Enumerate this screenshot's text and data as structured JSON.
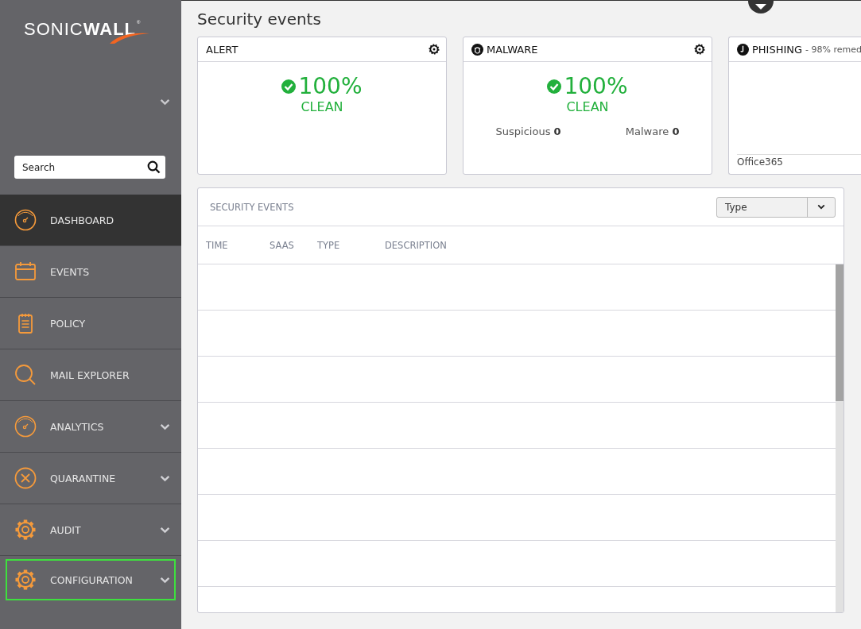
{
  "sidebar": {
    "logo": {
      "text": "SONIC**WALL**",
      "mark": "®"
    },
    "search": {
      "placeholder": "Search"
    },
    "items": [
      {
        "label": "DASHBOARD",
        "expandable": false,
        "selected": true,
        "focused": false
      },
      {
        "label": "EVENTS",
        "expandable": false,
        "selected": false,
        "focused": false
      },
      {
        "label": "POLICY",
        "expandable": false,
        "selected": false,
        "focused": false
      },
      {
        "label": "MAIL EXPLORER",
        "expandable": false,
        "selected": false,
        "focused": false
      },
      {
        "label": "ANALYTICS",
        "expandable": true,
        "selected": false,
        "focused": false
      },
      {
        "label": "QUARANTINE",
        "expandable": true,
        "selected": false,
        "focused": false
      },
      {
        "label": "AUDIT",
        "expandable": true,
        "selected": false,
        "focused": false
      },
      {
        "label": "CONFIGURATION",
        "expandable": true,
        "selected": false,
        "focused": true
      }
    ]
  },
  "page_title": "Security events",
  "cards": [
    {
      "kind": "status",
      "title": "ALERT",
      "settings": true,
      "percent": "100%",
      "status": "CLEAN"
    },
    {
      "kind": "status",
      "title": "MALWARE",
      "settings": true,
      "percent": "100%",
      "status": "CLEAN",
      "stats": [
        {
          "label": "Suspicious",
          "value": "0"
        },
        {
          "label": "Malware",
          "value": "0"
        }
      ]
    },
    {
      "kind": "chart",
      "title": "PHISHING",
      "subtitle": "- 98% remed",
      "footer": "Office365"
    }
  ],
  "events": {
    "title": "SECURITY EVENTS",
    "filter": {
      "value": "Type"
    },
    "columns": [
      "TIME",
      "SAAS",
      "TYPE",
      "DESCRIPTION"
    ]
  }
}
